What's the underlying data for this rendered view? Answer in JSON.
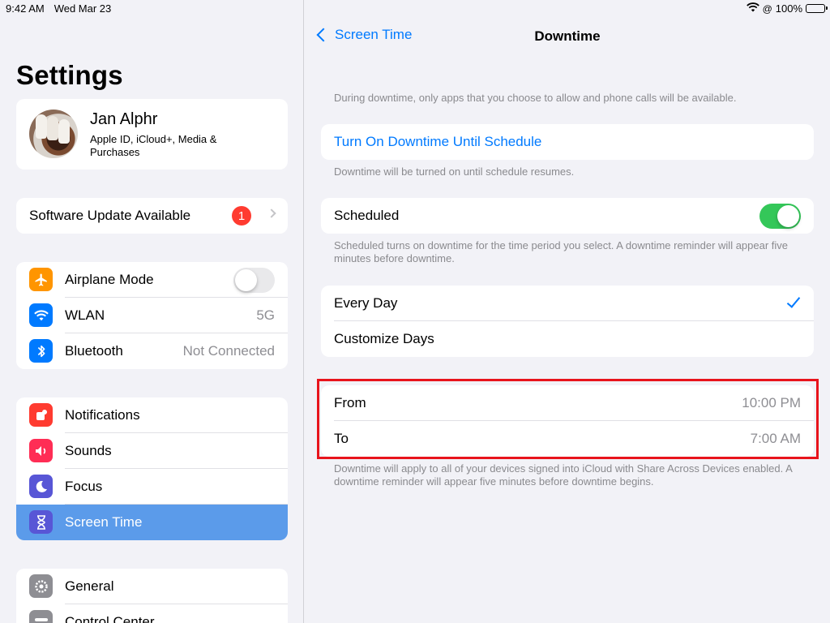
{
  "status_bar": {
    "time": "9:42 AM",
    "date": "Wed Mar 23",
    "battery": "100%",
    "battery_level": 1.0
  },
  "sidebar": {
    "title": "Settings",
    "profile": {
      "name": "Jan Alphr",
      "subtitle": "Apple ID, iCloud+, Media & Purchases"
    },
    "software_update": {
      "label": "Software Update Available",
      "badge": "1"
    },
    "network_items": [
      {
        "label": "Airplane Mode",
        "icon": "airplane-icon",
        "color": "#ff9500",
        "toggle": false
      },
      {
        "label": "WLAN",
        "icon": "wifi-icon",
        "color": "#007aff",
        "value": "5G"
      },
      {
        "label": "Bluetooth",
        "icon": "bluetooth-icon",
        "color": "#007aff",
        "value": "Not Connected"
      }
    ],
    "notification_items": [
      {
        "label": "Notifications",
        "icon": "notifications-icon",
        "color": "#ff3b30"
      },
      {
        "label": "Sounds",
        "icon": "sounds-icon",
        "color": "#ff2d55"
      },
      {
        "label": "Focus",
        "icon": "moon-icon",
        "color": "#5856d6"
      },
      {
        "label": "Screen Time",
        "icon": "hourglass-icon",
        "color": "#5856d6",
        "selected": true
      }
    ],
    "general_items": [
      {
        "label": "General",
        "icon": "gear-icon",
        "color": "#8e8e93"
      },
      {
        "label": "Control Center",
        "icon": "control-center-icon",
        "color": "#8e8e93"
      }
    ]
  },
  "main": {
    "back_label": "Screen Time",
    "title": "Downtime",
    "intro_note": "During downtime, only apps that you choose to allow and phone calls will be available.",
    "turn_on_label": "Turn On Downtime Until Schedule",
    "turn_on_note": "Downtime will be turned on until schedule resumes.",
    "scheduled": {
      "label": "Scheduled",
      "enabled": true,
      "note": "Scheduled turns on downtime for the time period you select. A downtime reminder will appear five minutes before downtime."
    },
    "day_options": [
      {
        "label": "Every Day",
        "checked": true
      },
      {
        "label": "Customize Days",
        "checked": false
      }
    ],
    "time_range": {
      "from_label": "From",
      "from_value": "10:00 PM",
      "to_label": "To",
      "to_value": "7:00 AM"
    },
    "footer_note": "Downtime will apply to all of your devices signed into iCloud with Share Across Devices enabled. A downtime reminder will appear five minutes before downtime begins."
  },
  "colors": {
    "accent": "#007aff",
    "toggle_on": "#34c759",
    "badge": "#ff3b30",
    "highlight": "#e8141c",
    "selected_row": "#5b9bea"
  }
}
